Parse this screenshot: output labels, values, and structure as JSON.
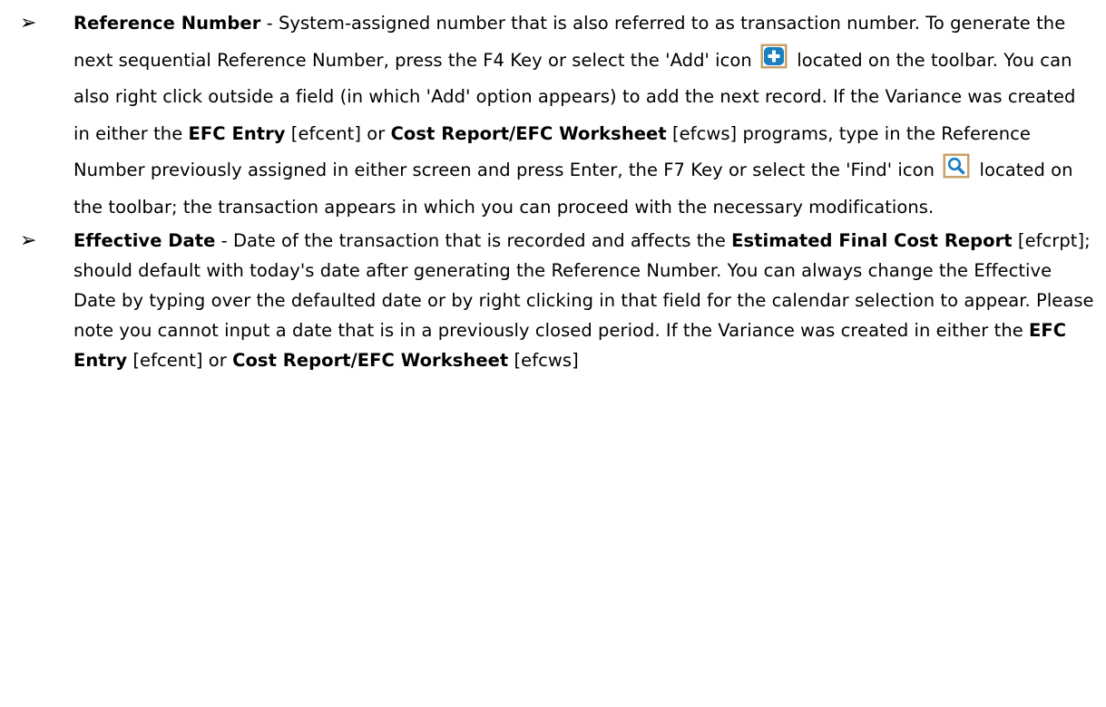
{
  "item1": {
    "term": "Reference Number",
    "t1": " - System-assigned number that is also referred to as transaction number.  To generate the next sequential Reference Number, press the F4 Key or select the 'Add' icon ",
    "t2": " located on the toolbar.  You can also right click outside a field (in which 'Add' option appears) to add the next record.  If the Variance was created in either the ",
    "link1": "EFC Entry",
    "t3": " [efcent] or ",
    "link2": "Cost Report/EFC Worksheet",
    "t4": " [efcws] programs, type in the Reference Number previously assigned in either screen and press Enter, the F7 Key or select the 'Find' icon ",
    "t5": " located on the toolbar; the transaction appears in which you can proceed with the necessary modifications."
  },
  "item2": {
    "term": "Effective Date",
    "t1": " - Date of the transaction that is recorded and affects the ",
    "link1": "Estimated Final Cost Report",
    "t2": " [efcrpt]; should default with today's date after generating the Reference Number. You can always change the Effective Date by typing over the defaulted date or by right clicking in that field for the calendar selection to appear.  Please note you cannot input a date that is in a previously closed period.  If the Variance was created in either the ",
    "link2": "EFC Entry",
    "t3": " [efcent] or ",
    "link3": "Cost Report/EFC Worksheet",
    "t4": " [efcws]"
  },
  "icons": {
    "add_icon": "plus-square-icon",
    "find_icon": "magnifier-icon",
    "icon_border_color": "#c8a06a",
    "icon_fill_color": "#1a7fc1"
  }
}
